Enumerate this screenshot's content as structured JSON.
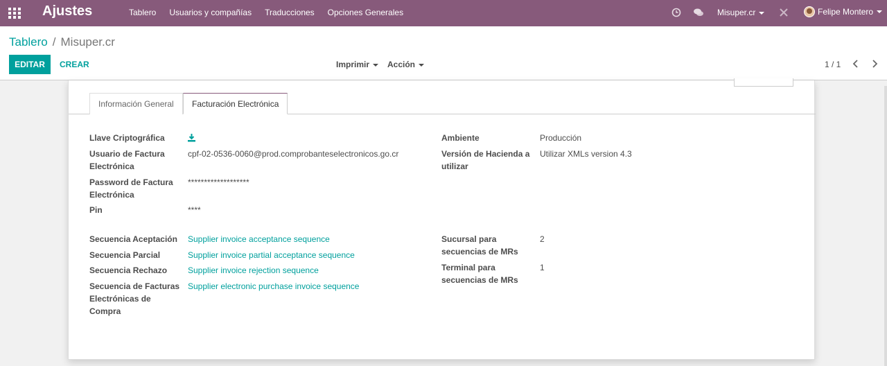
{
  "navbar": {
    "app_title": "Ajustes",
    "menu": [
      "Tablero",
      "Usuarios y compañías",
      "Traducciones",
      "Opciones Generales"
    ],
    "company": "Misuper.cr",
    "user": "Felipe Montero",
    "icons": [
      "apps-grid-icon",
      "clock-icon",
      "chat-icon",
      "tools-icon"
    ]
  },
  "breadcrumb": {
    "parent": "Tablero",
    "separator": "/",
    "current": "Misuper.cr"
  },
  "actions": {
    "edit": "EDITAR",
    "create": "CREAR",
    "print": "Imprimir",
    "action": "Acción"
  },
  "pager": {
    "value": "1 / 1"
  },
  "tabs": [
    "Información General",
    "Facturación Electrónica"
  ],
  "form": {
    "llave_label": "Llave Criptográfica",
    "usuario_label_1": "Usuario de Factura",
    "usuario_label_2": "Electrónica",
    "usuario_value": "cpf-02-0536-0060@prod.comprobanteselectronicos.go.cr",
    "password_label_1": "Password de Factura",
    "password_label_2": "Electrónica",
    "password_value": "*******************",
    "pin_label": "Pin",
    "pin_value": "****",
    "ambiente_label": "Ambiente",
    "ambiente_value": "Producción",
    "version_label_1": "Versión de Hacienda a",
    "version_label_2": "utilizar",
    "version_value": "Utilizar XMLs version 4.3",
    "seq_acept_label": "Secuencia Aceptación",
    "seq_acept_value": "Supplier invoice acceptance sequence",
    "seq_parcial_label": "Secuencia Parcial",
    "seq_parcial_value": "Supplier invoice partial acceptance sequence",
    "seq_rechazo_label": "Secuencia Rechazo",
    "seq_rechazo_value": "Supplier invoice rejection sequence",
    "seq_compra_label_1": "Secuencia de Facturas",
    "seq_compra_label_2": "Electrónicas de",
    "seq_compra_label_3": "Compra",
    "seq_compra_value": "Supplier electronic purchase invoice sequence",
    "sucursal_label_1": "Sucursal para",
    "sucursal_label_2": "secuencias de MRs",
    "sucursal_value": "2",
    "terminal_label_1": "Terminal para",
    "terminal_label_2": "secuencias de MRs",
    "terminal_value": "1"
  },
  "colors": {
    "navbar": "#875a7b",
    "accent": "#00a09d"
  }
}
